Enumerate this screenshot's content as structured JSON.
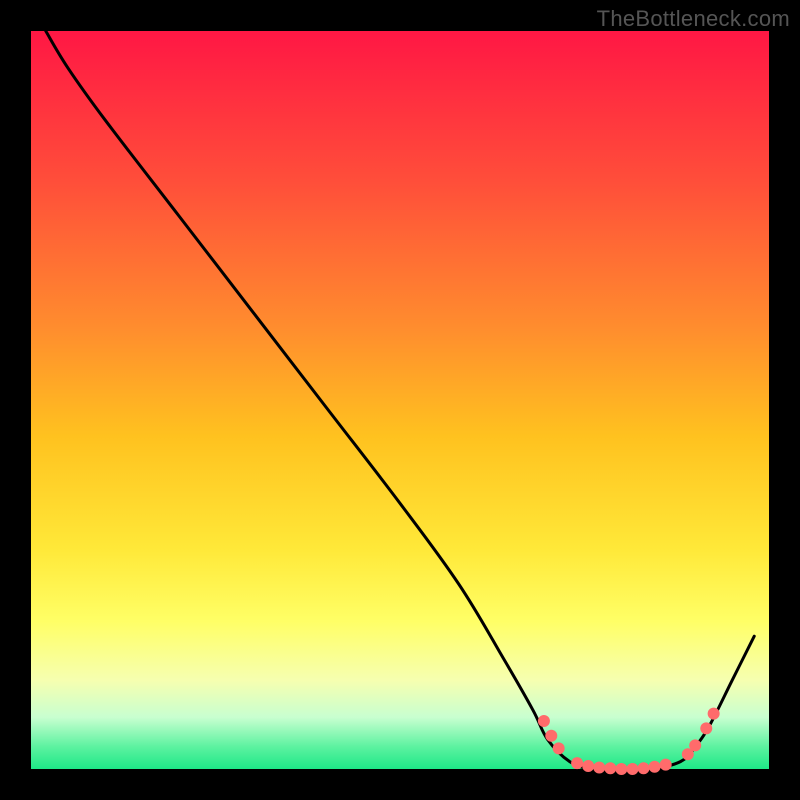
{
  "watermark": "TheBottleneck.com",
  "chart_data": {
    "type": "line",
    "title": "",
    "xlabel": "",
    "ylabel": "",
    "xlim": [
      0,
      100
    ],
    "ylim": [
      0,
      100
    ],
    "background_gradient": {
      "stops": [
        {
          "offset": 0,
          "color": "#ff1744"
        },
        {
          "offset": 20,
          "color": "#ff4d3a"
        },
        {
          "offset": 40,
          "color": "#ff8c2e"
        },
        {
          "offset": 55,
          "color": "#ffc21f"
        },
        {
          "offset": 70,
          "color": "#ffe838"
        },
        {
          "offset": 80,
          "color": "#ffff66"
        },
        {
          "offset": 88,
          "color": "#f6ffb0"
        },
        {
          "offset": 93,
          "color": "#c8ffd0"
        },
        {
          "offset": 97,
          "color": "#5cf2a0"
        },
        {
          "offset": 100,
          "color": "#1ee887"
        }
      ]
    },
    "series": [
      {
        "name": "bottleneck-curve",
        "color": "#000000",
        "points": [
          {
            "x": 2,
            "y": 100
          },
          {
            "x": 5,
            "y": 95
          },
          {
            "x": 10,
            "y": 88
          },
          {
            "x": 20,
            "y": 75
          },
          {
            "x": 30,
            "y": 62
          },
          {
            "x": 40,
            "y": 49
          },
          {
            "x": 50,
            "y": 36
          },
          {
            "x": 58,
            "y": 25
          },
          {
            "x": 64,
            "y": 15
          },
          {
            "x": 68,
            "y": 8
          },
          {
            "x": 70,
            "y": 4
          },
          {
            "x": 73,
            "y": 1
          },
          {
            "x": 76,
            "y": 0
          },
          {
            "x": 80,
            "y": 0
          },
          {
            "x": 84,
            "y": 0
          },
          {
            "x": 88,
            "y": 1
          },
          {
            "x": 90,
            "y": 3
          },
          {
            "x": 92,
            "y": 6
          },
          {
            "x": 95,
            "y": 12
          },
          {
            "x": 98,
            "y": 18
          }
        ]
      }
    ],
    "markers": {
      "color": "#ff6b6b",
      "radius": 6,
      "points": [
        {
          "x": 69.5,
          "y": 6.5
        },
        {
          "x": 70.5,
          "y": 4.5
        },
        {
          "x": 71.5,
          "y": 2.8
        },
        {
          "x": 74,
          "y": 0.8
        },
        {
          "x": 75.5,
          "y": 0.4
        },
        {
          "x": 77,
          "y": 0.2
        },
        {
          "x": 78.5,
          "y": 0.1
        },
        {
          "x": 80,
          "y": 0.0
        },
        {
          "x": 81.5,
          "y": 0.0
        },
        {
          "x": 83,
          "y": 0.1
        },
        {
          "x": 84.5,
          "y": 0.3
        },
        {
          "x": 86,
          "y": 0.6
        },
        {
          "x": 89,
          "y": 2.0
        },
        {
          "x": 90,
          "y": 3.2
        },
        {
          "x": 91.5,
          "y": 5.5
        },
        {
          "x": 92.5,
          "y": 7.5
        }
      ]
    }
  }
}
